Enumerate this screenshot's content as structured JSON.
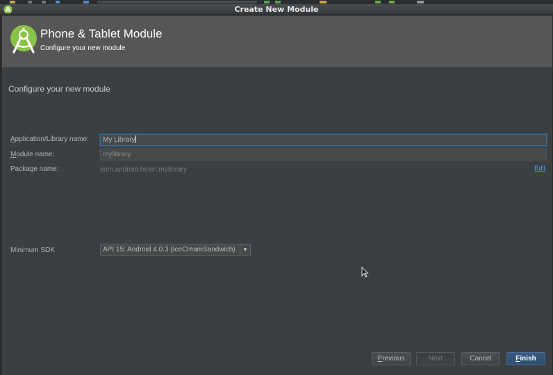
{
  "window": {
    "title": "Create New Module"
  },
  "header": {
    "title": "Phone & Tablet Module",
    "subtitle": "Configure your new module"
  },
  "main": {
    "heading": "Configure your new module",
    "fields": {
      "app_name": {
        "label_mnemonic": "A",
        "label_rest": "pplication/Library name:",
        "value": "My Library"
      },
      "module_name": {
        "label_mnemonic": "M",
        "label_rest": "odule name:",
        "value": "mylibrary"
      },
      "package_name": {
        "label": "Package name:",
        "value": "com.android.hexin.mylibrary",
        "edit_label": "Edit"
      },
      "min_sdk": {
        "label": "Minimum SDK",
        "selected": "API 15: Android 4.0.3 (IceCreamSandwich)"
      }
    }
  },
  "buttons": {
    "previous_mnemonic": "P",
    "previous_rest": "revious",
    "next": "Next",
    "cancel": "Cancel",
    "finish_mnemonic": "F",
    "finish_rest": "inish"
  },
  "colors": {
    "background": "#3c3f41",
    "header": "#565656",
    "android_green": "#8bc34a",
    "focus_blue": "#3c6a9a",
    "link_blue": "#589df6",
    "primary_button": "#365880"
  },
  "icons": {
    "window_icon": "android-studio-icon",
    "header_logo": "android-studio-logo",
    "dropdown": "chevron-down-icon",
    "pointer": "mouse-pointer-icon"
  }
}
